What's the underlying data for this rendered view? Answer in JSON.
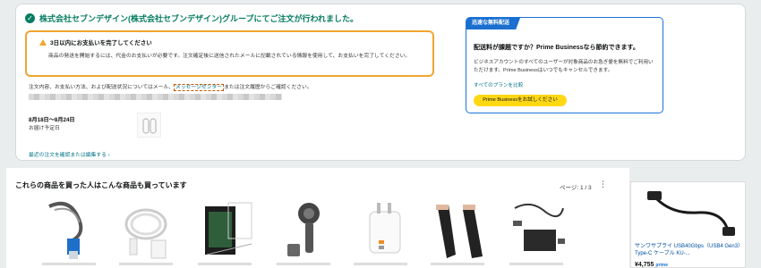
{
  "confirmation": {
    "title": "株式会社セブンデザイン(株式会社セブンデザイン)グループにてご注文が行われました。"
  },
  "warning": {
    "title": "3日以内にお支払いを完了してください",
    "body": "商品の発送を開始するには、代金のお支払いが必要です。注文確定後に送信されたメールに記載されている情報を使用して、お支払いを完了してください。"
  },
  "order_info": {
    "text_before": "注文内容、お支払い方法、および配送状況についてはメール、",
    "link": "メッセージセンター",
    "text_after": "または注文履歴からご確認ください。"
  },
  "delivery": {
    "date": "8月18日〜8月24日",
    "label": "お届け予定日"
  },
  "edit_link": "最近の注文を確認または編集する ›",
  "prime": {
    "badge": "迅速な無料配送",
    "title": "配送料が課題ですか？Prime Businessなら節約できます。",
    "body": "ビジネスアカウントのすべてのユーザーが対象商品のお急ぎ便を無料でご利用いただけます。Prime Businessはいつでもキャンセルできます。",
    "link": "すべてのプランを比較",
    "button": "Prime Businessをお試しください",
    "accent": "#1a6fcf",
    "button_color": "#ffd814"
  },
  "recommendations": {
    "title": "これらの商品を買った人はこんな商品も買っています",
    "page": "ページ: 1 / 3"
  },
  "side_product": {
    "name": "サンワサプライ USB40Gbps（USB4 Gen3）Type-C ケーブル KU-...",
    "price": "¥4,755",
    "badge": "prime"
  }
}
